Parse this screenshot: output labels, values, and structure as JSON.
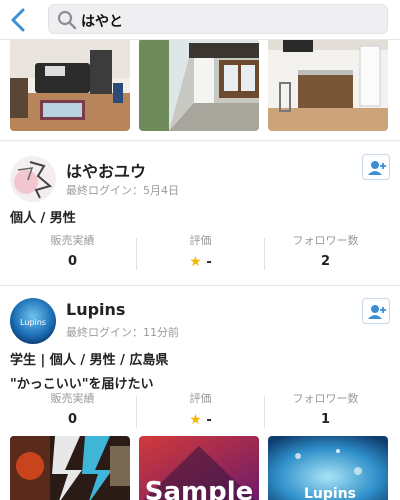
{
  "header": {
    "search_query": "はやと"
  },
  "profiles": [
    {
      "name": "はやおユウ",
      "last_login": "最終ログイン：5月4日",
      "tags": "個人 / 男性",
      "stats": [
        {
          "label": "販売実績",
          "value": "0"
        },
        {
          "label": "評価",
          "value": "-"
        },
        {
          "label": "フォロワー数",
          "value": "2"
        }
      ]
    },
    {
      "name": "Lupins",
      "last_login": "最終ログイン：11分前",
      "tags": "学生 | 個人 / 男性 / 広島県",
      "bio": "\"かっこいい\"を届けたい",
      "avatar_text": "Lupins",
      "stats": [
        {
          "label": "販売実績",
          "value": "0"
        },
        {
          "label": "評価",
          "value": "-"
        },
        {
          "label": "フォロワー数",
          "value": "1"
        }
      ]
    }
  ],
  "thumbnails_bottom": {
    "sample_text": "Sample",
    "lupins_text": "Lupins"
  },
  "colors": {
    "accent": "#3a8fd6",
    "star": "#f5b800"
  }
}
